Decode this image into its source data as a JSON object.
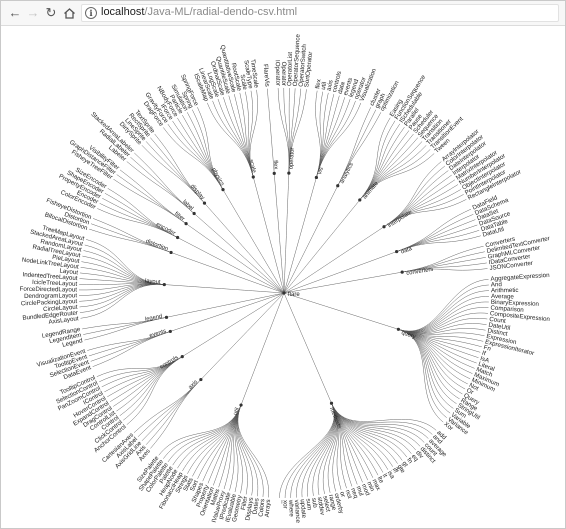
{
  "browser": {
    "url_host": "localhost",
    "url_path": "/Java-ML/radial-dendo-csv.html",
    "info_icon": "info-icon",
    "icons": {
      "back": "back-arrow-icon",
      "forward": "forward-arrow-icon",
      "reload": "reload-icon",
      "home": "home-icon"
    }
  },
  "dendrogram": {
    "root": "flare",
    "branches": [
      {
        "name": "vis",
        "leaves": [
          "flex",
          "util",
          "axis",
          "controls",
          "data",
          "events",
          "legend",
          "operator",
          "Visualization"
        ]
      },
      {
        "name": "analytics",
        "leaves": [
          "cluster",
          "graph",
          "optimization"
        ]
      },
      {
        "name": "animate",
        "leaves": [
          "Easing",
          "FunctionSequence",
          "ISchedulable",
          "Parallel",
          "Pause",
          "Scheduler",
          "Sequence",
          "Transition",
          "Transitioner",
          "TransitionEvent",
          "Tween"
        ]
      },
      {
        "name": "interpolate",
        "leaves": [
          "ArrayInterpolator",
          "ColorInterpolator",
          "DateInterpolator",
          "Interpolator",
          "MatrixInterpolator",
          "NumberInterpolator",
          "ObjectInterpolator",
          "PointInterpolator",
          "RectangleInterpolator"
        ]
      },
      {
        "name": "data",
        "leaves": [
          "DataField",
          "DataSchema",
          "DataSet",
          "DataSource",
          "DataTable",
          "DataUtil"
        ]
      },
      {
        "name": "converters",
        "leaves": [
          "Converters",
          "DelimitedTextConverter",
          "GraphMLConverter",
          "IDataConverter",
          "JSONConverter"
        ]
      },
      {
        "name": "query",
        "leaves": [
          "AggregateExpression",
          "And",
          "Arithmetic",
          "Average",
          "BinaryExpression",
          "Comparison",
          "CompositeExpression",
          "Count",
          "DateUtil",
          "Distinct",
          "Expression",
          "ExpressionIterator",
          "Fn",
          "If",
          "IsA",
          "Literal",
          "Match",
          "Maximum",
          "Minimum",
          "Not",
          "Or",
          "Query",
          "Range",
          "StringUtil",
          "Sum",
          "Variable",
          "Variance",
          "Xor"
        ]
      },
      {
        "name": "methods",
        "leaves": [
          "add",
          "and",
          "average",
          "count",
          "distinct",
          "div",
          "eq",
          "fn",
          "gt",
          "gte",
          "iff",
          "isa",
          "lt",
          "lte",
          "max",
          "min",
          "mod",
          "mul",
          "neq",
          "not",
          "or",
          "orderby",
          "range",
          "select",
          "stddev",
          "sub",
          "sum",
          "update",
          "variance",
          "where",
          "xor",
          "_"
        ]
      },
      {
        "name": "util",
        "leaves": [
          "Arrays",
          "Colors",
          "Dates",
          "Displays",
          "Filter",
          "Geometry",
          "IEvaluable",
          "IPredicate",
          "IValueProxy",
          "Maths",
          "Orientation",
          "Property",
          "Shapes",
          "Sort",
          "Stats",
          "Strings",
          "FibonacciHeap",
          "HeapNode",
          "Palette",
          "ColorPalette",
          "ShapePalette",
          "SizePalette"
        ]
      },
      {
        "name": "axis",
        "leaves": [
          "Axes",
          "Axis",
          "AxisGridLine",
          "AxisLabel",
          "CartesianAxes"
        ]
      },
      {
        "name": "controls",
        "leaves": [
          "AnchorControl",
          "ClickControl",
          "Control",
          "ControlList",
          "DragControl",
          "ExpandControl",
          "HoverControl",
          "IControl",
          "PanZoomControl",
          "SelectionControl",
          "TooltipControl"
        ]
      },
      {
        "name": "events",
        "leaves": [
          "DataEvent",
          "SelectionEvent",
          "TooltipEvent",
          "VisualizationEvent"
        ]
      },
      {
        "name": "legend",
        "leaves": [
          "Legend",
          "LegendItem",
          "LegendRange"
        ]
      },
      {
        "name": "layout",
        "leaves": [
          "AxisLayout",
          "BundledEdgeRouter",
          "CircleLayout",
          "CirclePackingLayout",
          "DendrogramLayout",
          "ForceDirectedLayout",
          "IcicleTreeLayout",
          "IndentedTreeLayout",
          "Layout",
          "NodeLinkTreeLayout",
          "PieLayout",
          "RadialTreeLayout",
          "RandomLayout",
          "StackedAreaLayout",
          "TreeMapLayout"
        ]
      },
      {
        "name": "distortion",
        "leaves": [
          "BifocalDistortion",
          "Distortion",
          "FisheyeDistortion"
        ]
      },
      {
        "name": "encoder",
        "leaves": [
          "ColorEncoder",
          "Encoder",
          "PropertyEncoder",
          "ShapeEncoder",
          "SizeEncoder"
        ]
      },
      {
        "name": "filter",
        "leaves": [
          "FisheyeTreeFilter",
          "GraphDistanceFilter",
          "VisibilityFilter"
        ]
      },
      {
        "name": "label",
        "leaves": [
          "Labeler",
          "RadialLabeler",
          "StackedAreaLabeler"
        ]
      },
      {
        "name": "display",
        "leaves": [
          "DirtySprite",
          "LineSprite",
          "RectSprite",
          "TextSprite"
        ]
      },
      {
        "name": "physics",
        "leaves": [
          "DragForce",
          "GravityForce",
          "IForce",
          "NBodyForce",
          "Particle",
          "Simulation",
          "Spring",
          "SpringForce"
        ]
      },
      {
        "name": "scale",
        "leaves": [
          "IScaleMap",
          "LinearScale",
          "LogScale",
          "OrdinalScale",
          "QuantileScale",
          "QuantitativeScale",
          "RootScale",
          "Scale",
          "ScaleType",
          "TimeScale"
        ]
      },
      {
        "name": "flex",
        "leaves": [
          "FlareVis"
        ]
      },
      {
        "name": "operator",
        "leaves": [
          "IOperator",
          "Operator",
          "OperatorList",
          "OperatorSequence",
          "OperatorSwitch",
          "SortOperator"
        ]
      }
    ]
  },
  "colors": {
    "link": "#555555",
    "node": "#333333",
    "text": "#222222",
    "toolbar": "#f7f7f7"
  }
}
